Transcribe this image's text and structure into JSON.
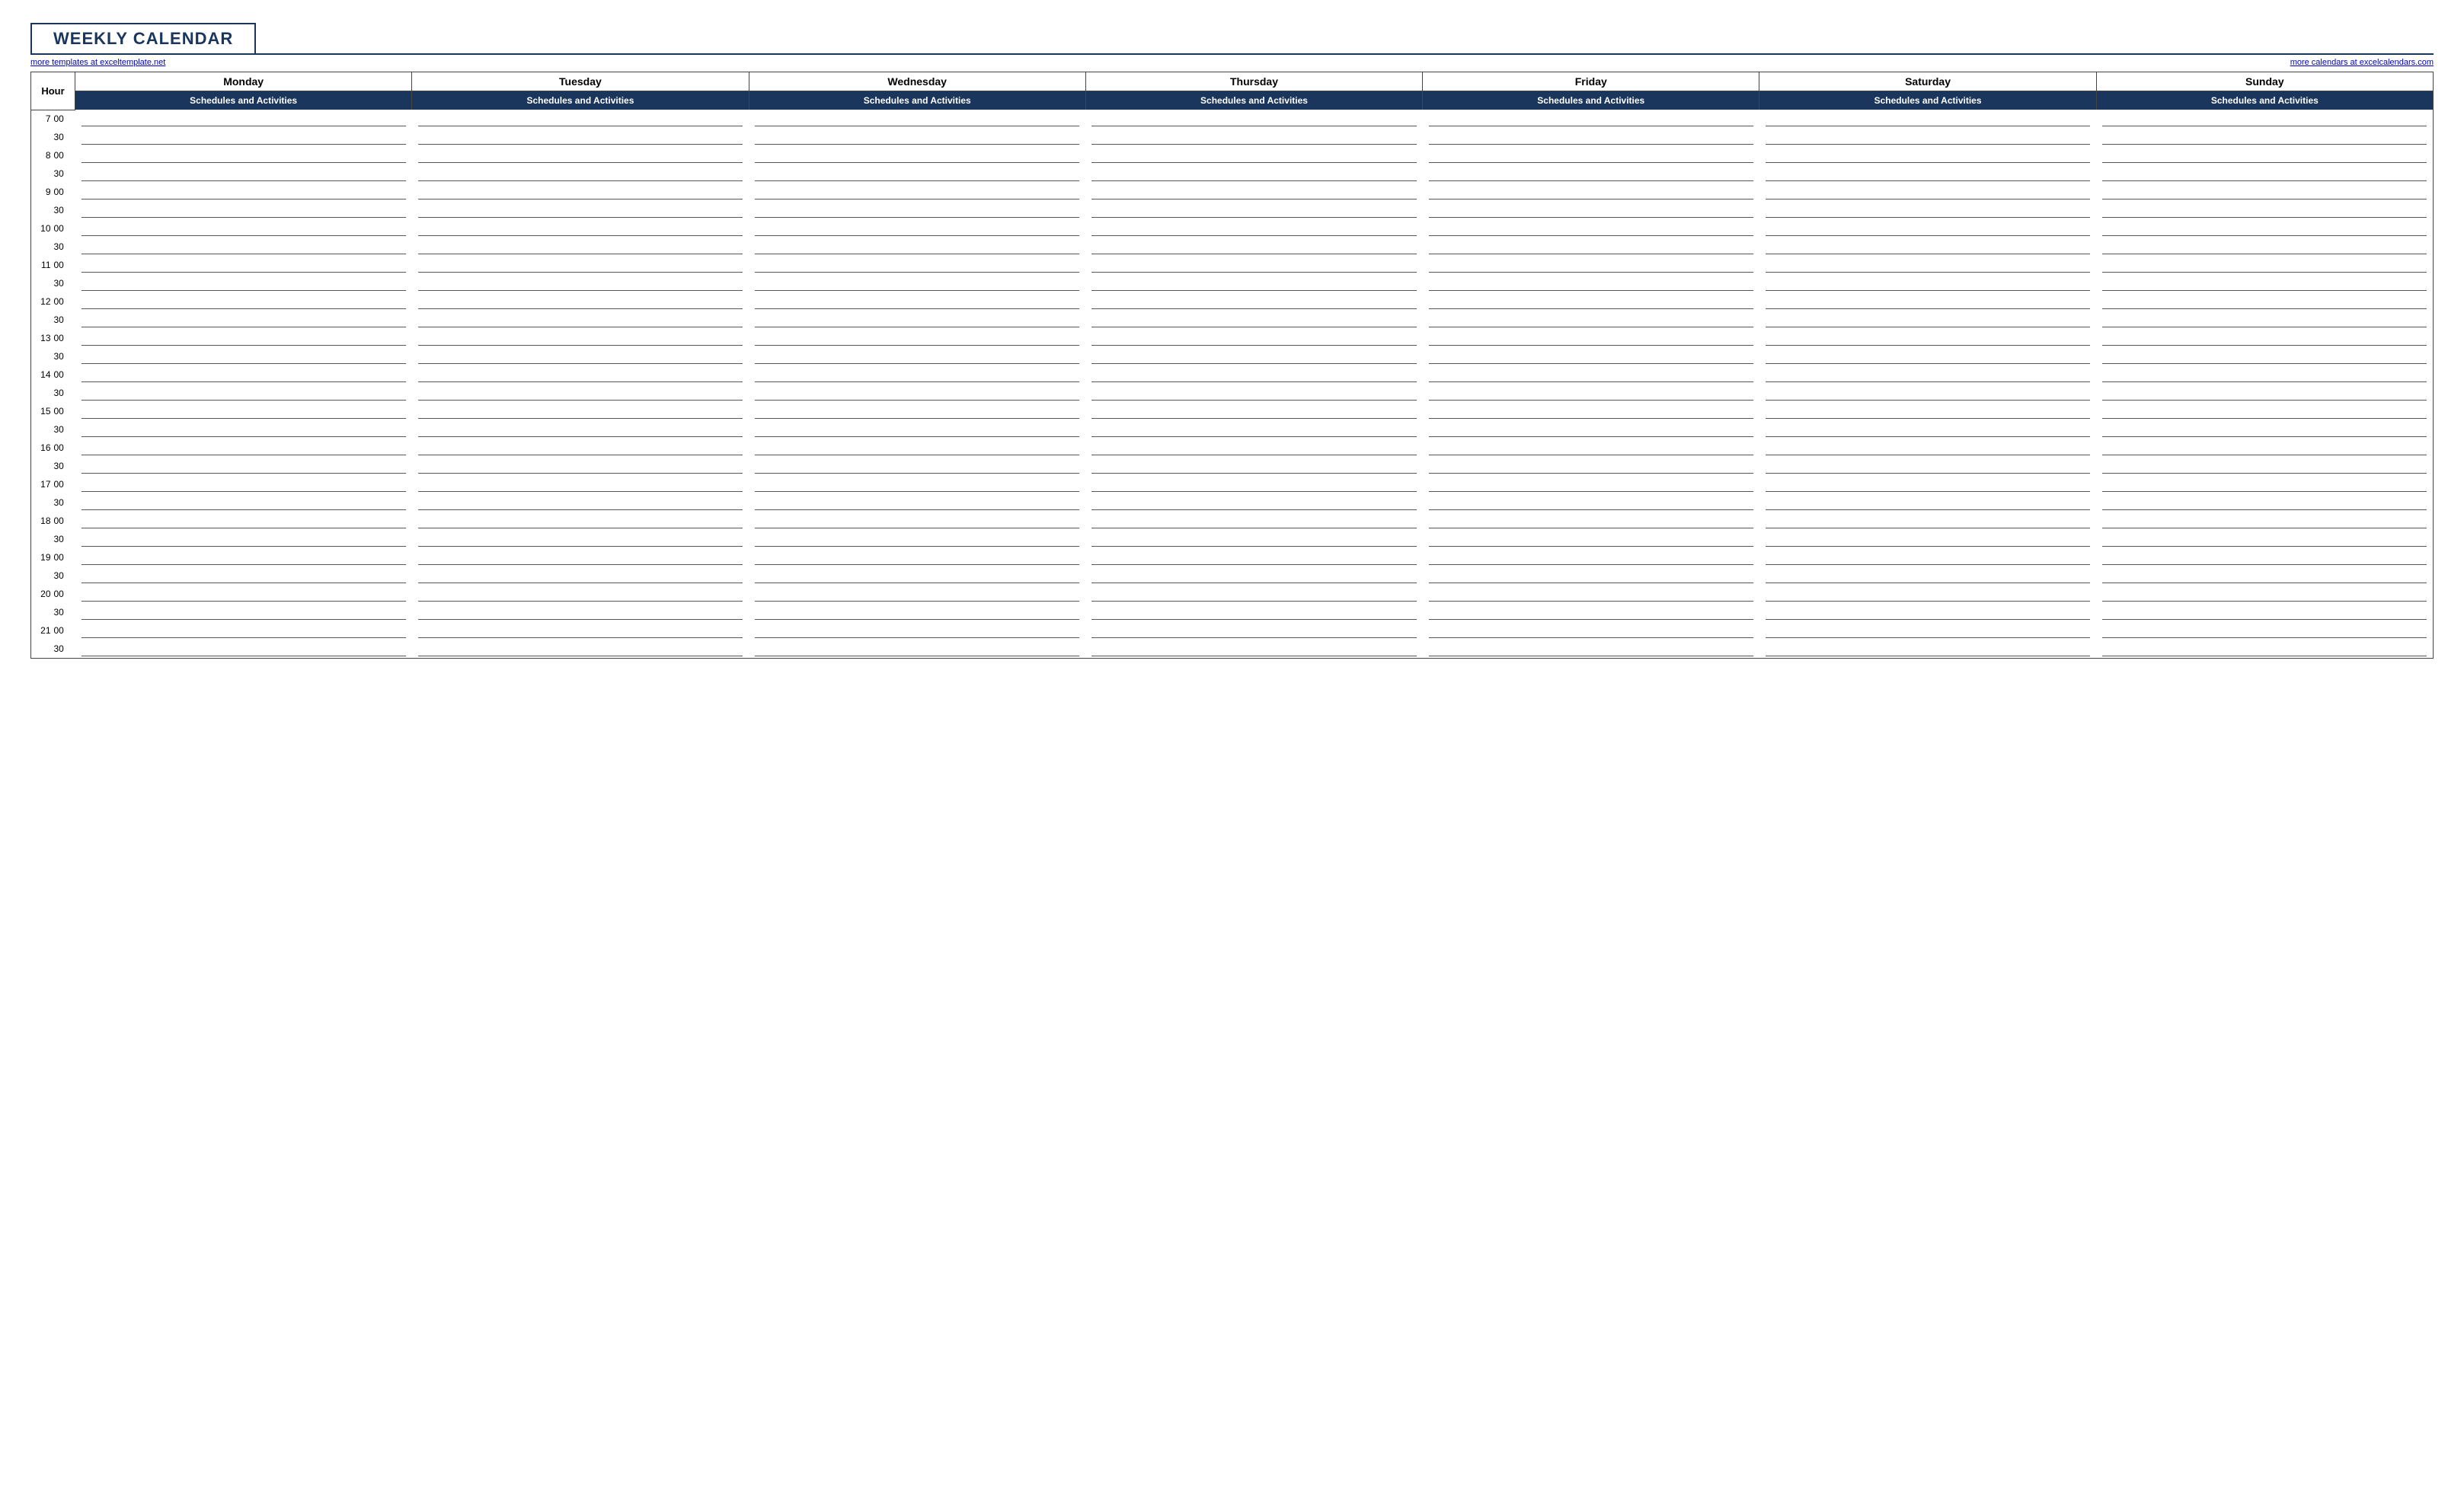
{
  "title": "WEEKLY CALENDAR",
  "links": {
    "left": "more templates at exceltemplate.net",
    "right": "more calendars at excelcalendars.com"
  },
  "header": {
    "hour_label": "Hour",
    "days": [
      "Monday",
      "Tuesday",
      "Wednesday",
      "Thursday",
      "Friday",
      "Saturday",
      "Sunday"
    ],
    "subheader": "Schedules and Activities"
  },
  "time_slots": [
    {
      "hour": "7",
      "minute": "00"
    },
    {
      "hour": "",
      "minute": "30"
    },
    {
      "hour": "8",
      "minute": "00"
    },
    {
      "hour": "",
      "minute": "30"
    },
    {
      "hour": "9",
      "minute": "00"
    },
    {
      "hour": "",
      "minute": "30"
    },
    {
      "hour": "10",
      "minute": "00"
    },
    {
      "hour": "",
      "minute": "30"
    },
    {
      "hour": "11",
      "minute": "00"
    },
    {
      "hour": "",
      "minute": "30"
    },
    {
      "hour": "12",
      "minute": "00"
    },
    {
      "hour": "",
      "minute": "30"
    },
    {
      "hour": "13",
      "minute": "00"
    },
    {
      "hour": "",
      "minute": "30"
    },
    {
      "hour": "14",
      "minute": "00"
    },
    {
      "hour": "",
      "minute": "30"
    },
    {
      "hour": "15",
      "minute": "00"
    },
    {
      "hour": "",
      "minute": "30"
    },
    {
      "hour": "16",
      "minute": "00"
    },
    {
      "hour": "",
      "minute": "30"
    },
    {
      "hour": "17",
      "minute": "00"
    },
    {
      "hour": "",
      "minute": "30"
    },
    {
      "hour": "18",
      "minute": "00"
    },
    {
      "hour": "",
      "minute": "30"
    },
    {
      "hour": "19",
      "minute": "00"
    },
    {
      "hour": "",
      "minute": "30"
    },
    {
      "hour": "20",
      "minute": "00"
    },
    {
      "hour": "",
      "minute": "30"
    },
    {
      "hour": "21",
      "minute": "00"
    },
    {
      "hour": "",
      "minute": "30"
    }
  ]
}
